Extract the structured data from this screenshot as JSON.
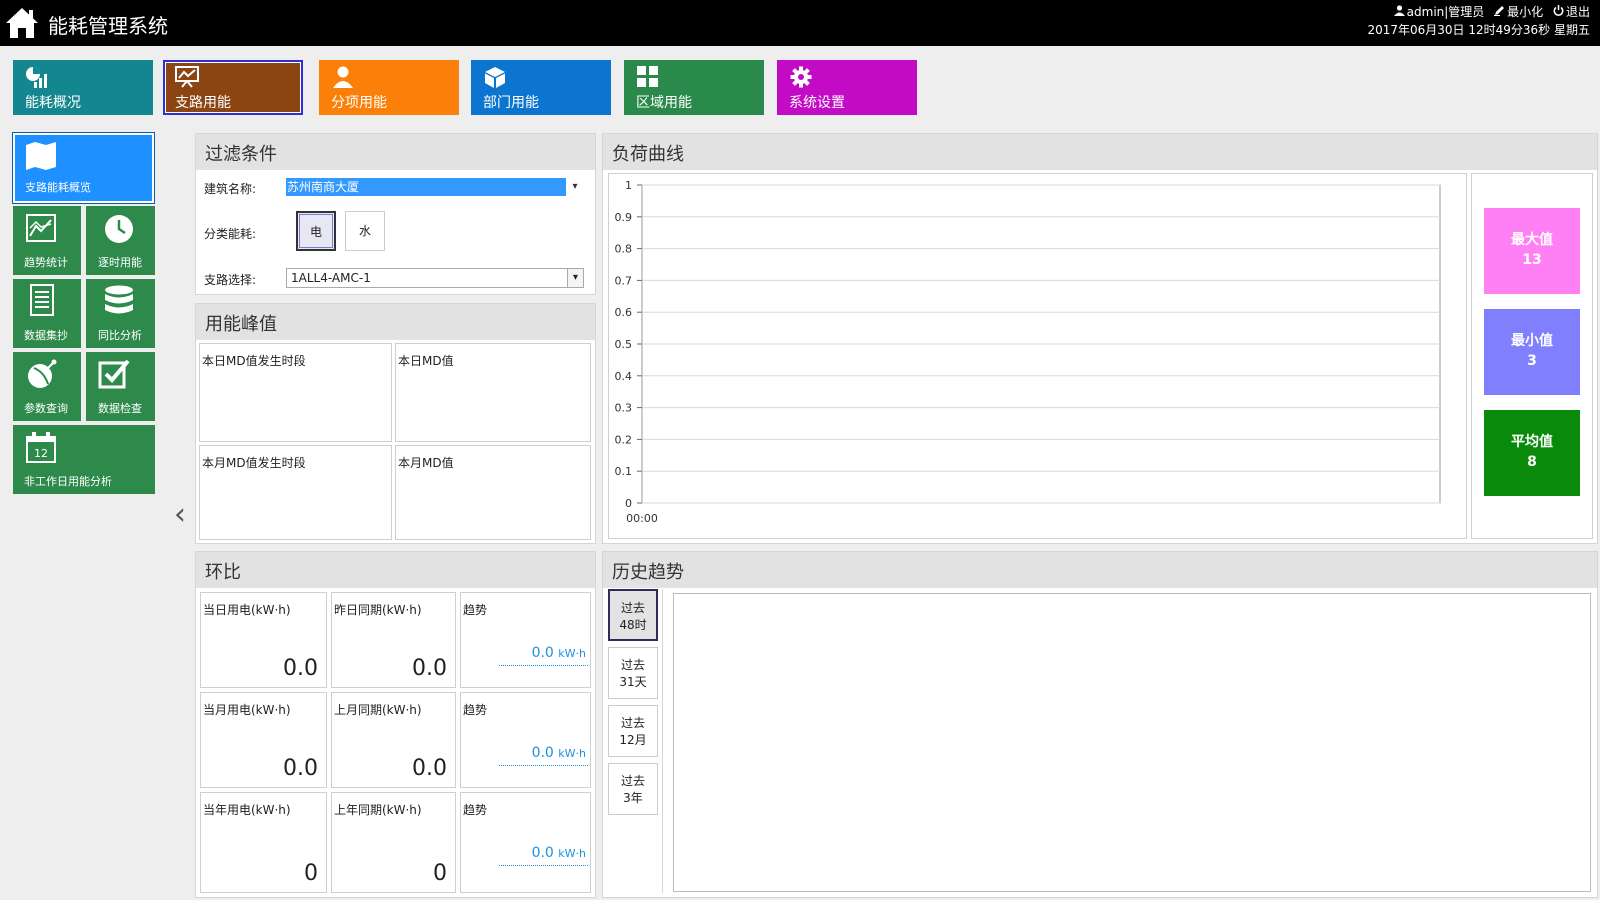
{
  "header": {
    "title": "能耗管理系统",
    "user": "admin|管理员",
    "minimize": "最小化",
    "logout": "退出",
    "datetime": "2017年06月30日 12时49分36秒 星期五"
  },
  "modules": [
    {
      "label": "能耗概况",
      "color": "#14868f",
      "icon": "overview-icon"
    },
    {
      "label": "支路用能",
      "color": "#8b4513",
      "icon": "branch-chart-icon",
      "active": true
    },
    {
      "label": "分项用能",
      "color": "#fb8009",
      "icon": "user-icon"
    },
    {
      "label": "部门用能",
      "color": "#0b75d0",
      "icon": "cube-icon"
    },
    {
      "label": "区域用能",
      "color": "#2a8a4c",
      "icon": "grid-icon"
    },
    {
      "label": "系统设置",
      "color": "#c30bc6",
      "icon": "gear-icon"
    }
  ],
  "sidebar": {
    "items": [
      {
        "label": "支路能耗概览",
        "icon": "map-icon",
        "color": "#1e90ff",
        "active": true
      },
      {
        "label": "趋势统计",
        "icon": "trend-icon",
        "color": "#2d8a4a"
      },
      {
        "label": "逐时用能",
        "icon": "clock-icon",
        "color": "#2d8a4a"
      },
      {
        "label": "数据集抄",
        "icon": "document-icon",
        "color": "#2d8a4a"
      },
      {
        "label": "同比分析",
        "icon": "database-icon",
        "color": "#2d8a4a"
      },
      {
        "label": "参数查询",
        "icon": "satellite-icon",
        "color": "#2d8a4a"
      },
      {
        "label": "数据检查",
        "icon": "checkbox-icon",
        "color": "#2d8a4a"
      },
      {
        "label": "非工作日用能分析",
        "icon": "calendar-icon",
        "color": "#2d8a4a",
        "calendar_day": "12"
      }
    ]
  },
  "filter": {
    "title": "过滤条件",
    "building_label": "建筑名称:",
    "building_value": "苏州南商大厦",
    "category_label": "分类能耗:",
    "category_options": [
      "电",
      "水"
    ],
    "category_selected": "电",
    "branch_label": "支路选择:",
    "branch_value": "1ALL4-AMC-1"
  },
  "peak": {
    "title": "用能峰值",
    "cells": [
      "本日MD值发生时段",
      "本日MD值",
      "本月MD值发生时段",
      "本月MD值"
    ]
  },
  "ratio": {
    "title": "环比",
    "rows": [
      {
        "current_label": "当日用电(kW·h)",
        "current_value": "0.0",
        "prev_label": "昨日同期(kW·h)",
        "prev_value": "0.0",
        "trend_label": "趋势",
        "trend_value": "0.0",
        "trend_unit": "kW·h"
      },
      {
        "current_label": "当月用电(kW·h)",
        "current_value": "0.0",
        "prev_label": "上月同期(kW·h)",
        "prev_value": "0.0",
        "trend_label": "趋势",
        "trend_value": "0.0",
        "trend_unit": "kW·h"
      },
      {
        "current_label": "当年用电(kW·h)",
        "current_value": "0",
        "prev_label": "上年同期(kW·h)",
        "prev_value": "0",
        "trend_label": "趋势",
        "trend_value": "0.0",
        "trend_unit": "kW·h"
      }
    ]
  },
  "load_curve": {
    "title": "负荷曲线",
    "stats": [
      {
        "label": "最大值",
        "value": "13",
        "color": "#ff7ff5"
      },
      {
        "label": "最小值",
        "value": "3",
        "color": "#8080ff"
      },
      {
        "label": "平均值",
        "value": "8",
        "color": "#0a8a0a"
      }
    ]
  },
  "history": {
    "title": "历史趋势",
    "buttons": [
      {
        "line1": "过去",
        "line2": "48时",
        "active": true
      },
      {
        "line1": "过去",
        "line2": "31天"
      },
      {
        "line1": "过去",
        "line2": "12月"
      },
      {
        "line1": "过去",
        "line2": "3年"
      }
    ]
  },
  "chart_data": {
    "type": "line",
    "x": [
      "00:00"
    ],
    "series": [],
    "yticks": [
      "0",
      "0.1",
      "0.2",
      "0.3",
      "0.4",
      "0.5",
      "0.6",
      "0.7",
      "0.8",
      "0.9",
      "1"
    ],
    "ylim": [
      0,
      1
    ],
    "grid": true
  }
}
